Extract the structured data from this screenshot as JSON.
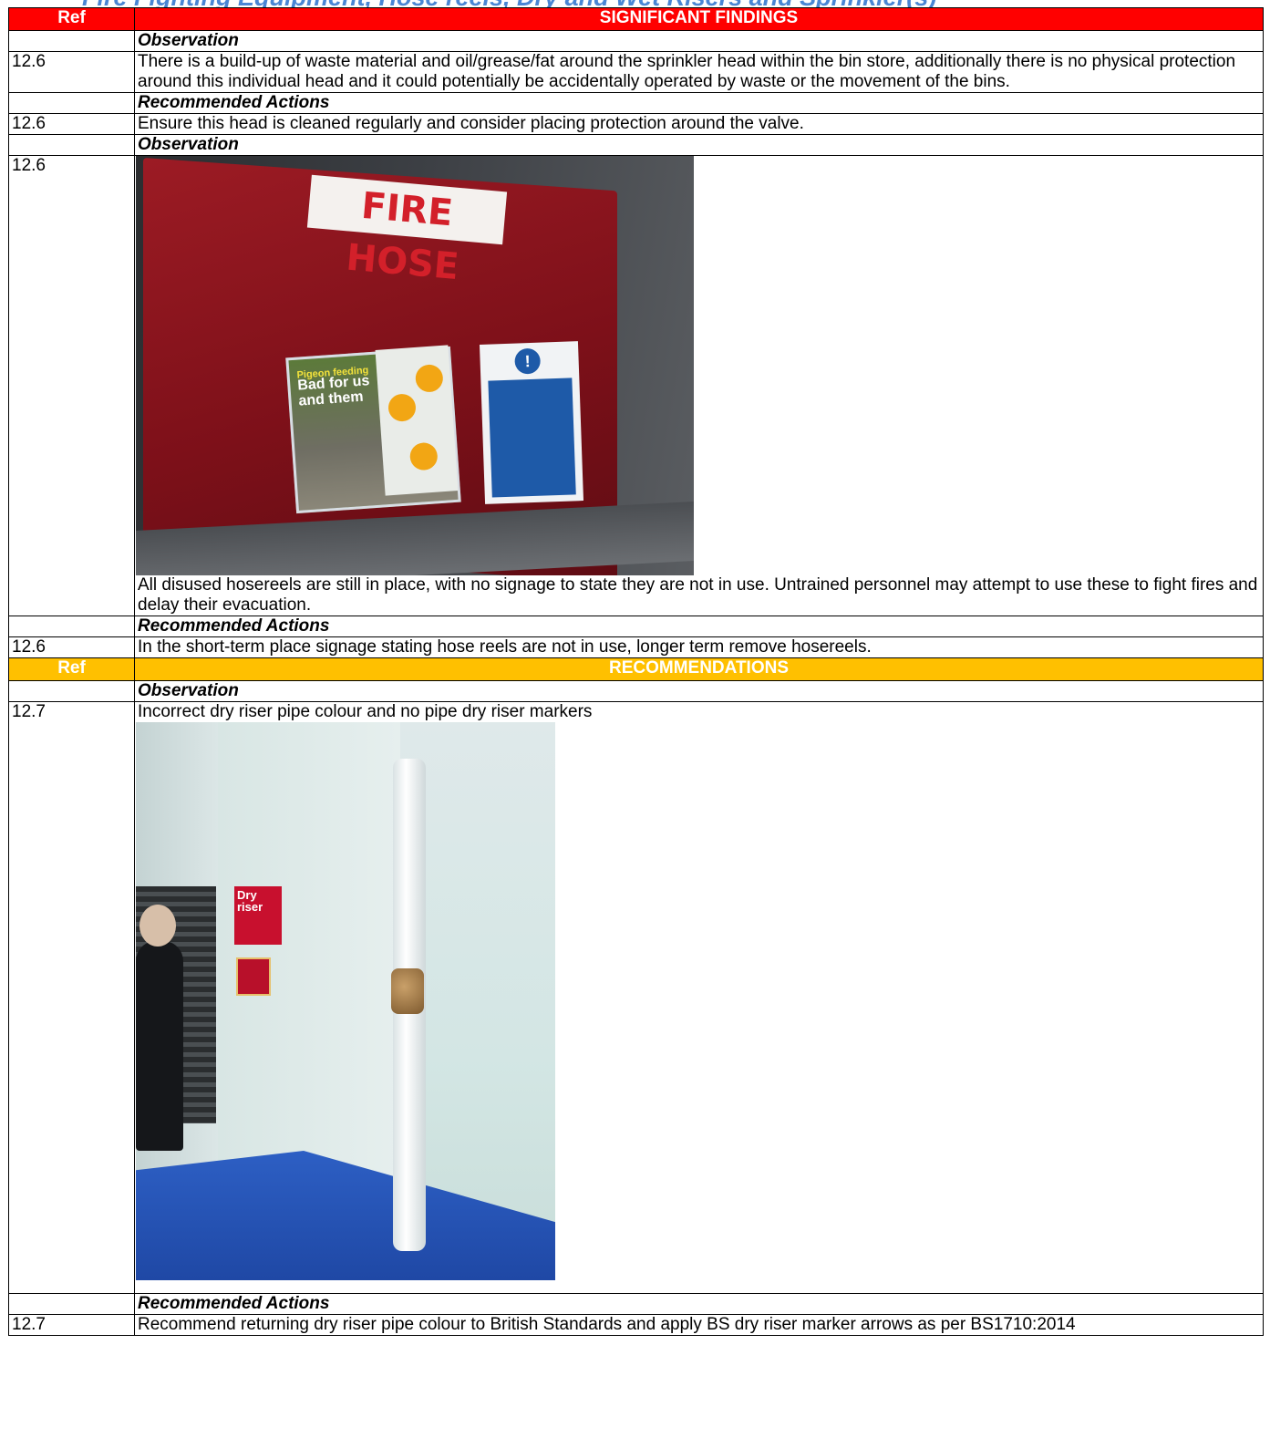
{
  "page_heading": "Fire Fighting Equipment, Hose reels, Dry and Wet Risers and Sprinkler(s)",
  "section1": {
    "ref_header": "Ref",
    "title": "SIGNIFICANT FINDINGS",
    "observation_label": "Observation",
    "recommended_label": "Recommended Actions",
    "items": [
      {
        "ref": "12.6",
        "observation": "There is a build-up of waste material and oil/grease/fat around the sprinkler head within the bin store, additionally there is no physical protection around this individual head and it could potentially be accidentally operated by waste or the movement of the bins.",
        "action_ref": "12.6",
        "action": "Ensure this head is cleaned regularly and consider placing protection around the valve."
      },
      {
        "ref": "12.6",
        "photo_icon": "fire-hose-cabinet-photo",
        "photo_text": {
          "sign": "FIRE HOSE",
          "poster_tag": "Pigeon feeding",
          "poster_line1": "Bad for us",
          "poster_line2": "and them"
        },
        "observation": "All disused hosereels are still in place, with no signage to state they are not in use. Untrained personnel may attempt to use these to fight fires and delay their evacuation.",
        "action_ref": "12.6",
        "action": "In the short-term place signage stating hose reels are not in use, longer term remove hosereels."
      }
    ]
  },
  "section2": {
    "ref_header": "Ref",
    "title": "RECOMMENDATIONS",
    "observation_label": "Observation",
    "recommended_label": "Recommended Actions",
    "item": {
      "ref": "12.7",
      "observation": "Incorrect dry riser pipe colour and no pipe dry riser markers",
      "photo_icon": "dry-riser-pipe-photo",
      "photo_text": {
        "sign": "Dry riser"
      },
      "action_ref": "12.7",
      "action": "Recommend returning dry riser pipe colour to British Standards  and apply BS dry riser marker arrows as per BS1710:2014"
    }
  },
  "colors": {
    "header_red": "#ff0000",
    "header_amber": "#ffc000",
    "heading_blue": "#4a86d4"
  }
}
